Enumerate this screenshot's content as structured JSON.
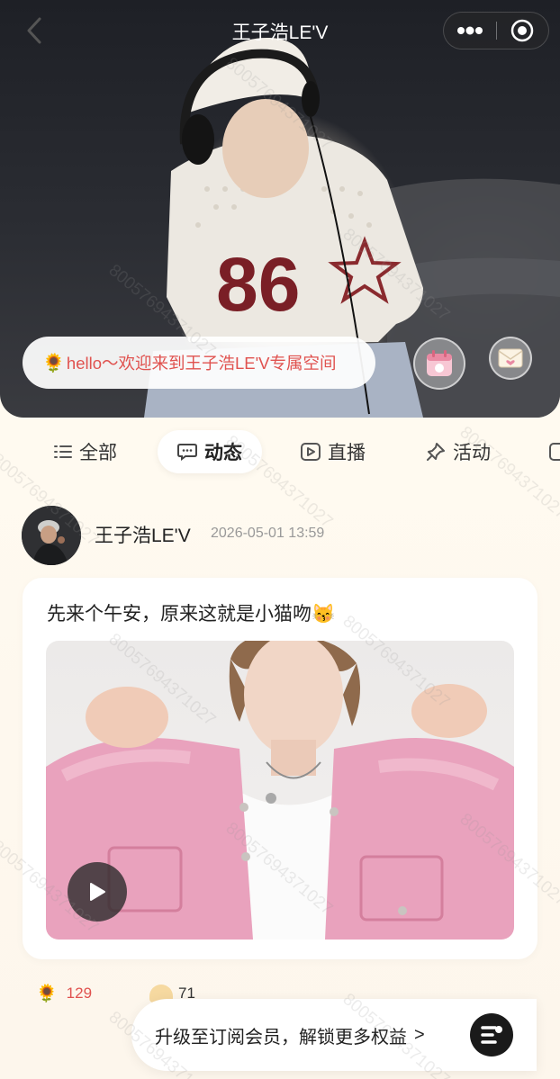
{
  "header": {
    "title": "王子浩LE'V",
    "back_icon": "chevron-left-icon",
    "more_icon": "more-dots-icon",
    "close_icon": "target-circle-icon"
  },
  "hero": {
    "welcome_emoji": "🌻",
    "welcome_text": "hello～欢迎来到王子浩LE'V专属空间",
    "calendar_icon": "calendar-sticker-icon",
    "letter_icon": "envelope-icon"
  },
  "tabs": [
    {
      "label": "全部",
      "icon": "list-icon",
      "active": false
    },
    {
      "label": "动态",
      "icon": "chat-bubble-icon",
      "active": true
    },
    {
      "label": "直播",
      "icon": "live-play-icon",
      "active": false
    },
    {
      "label": "活动",
      "icon": "pin-icon",
      "active": false
    }
  ],
  "post": {
    "author": "王子浩LE'V",
    "timestamp": "2026-05-01 13:59",
    "text": "先来个午安，原来这就是小猫吻😽",
    "media_type": "video"
  },
  "reactions": [
    {
      "emoji": "🌻",
      "count": "129"
    },
    {
      "emoji": "blob",
      "count": "71"
    }
  ],
  "upgrade": {
    "text": "升级至订阅会员，解锁更多权益",
    "arrow": ">"
  },
  "watermark": "80057694371027"
}
